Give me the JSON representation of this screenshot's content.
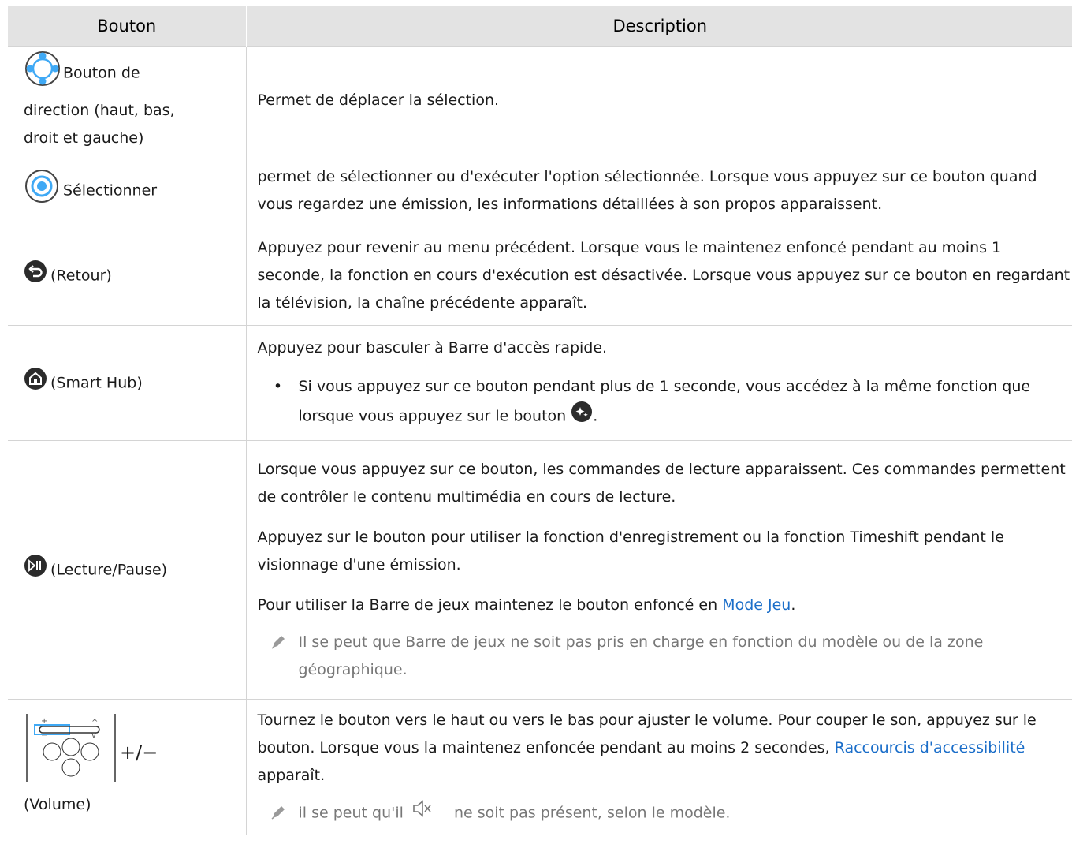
{
  "table": {
    "headers": [
      "Bouton",
      "Description"
    ],
    "rows": [
      {
        "button_label": "Bouton de direction (haut, bas, droit et gauche)",
        "icon": "direction-pad-icon",
        "description": [
          "Permet de déplacer la sélection."
        ]
      },
      {
        "button_label": "Sélectionner",
        "icon": "select-button-icon",
        "description": [
          "permet de sélectionner ou d'exécuter l'option sélectionnée. Lorsque vous appuyez sur ce bouton quand vous regardez une émission, les informations détaillées à son propos apparaissent."
        ]
      },
      {
        "button_label": "(Retour)",
        "icon": "back-icon",
        "description": [
          "Appuyez pour revenir au menu précédent. Lorsque vous le maintenez enfoncé pendant au moins 1 seconde, la fonction en cours d'exécution est désactivée. Lorsque vous appuyez sur ce bouton en regardant la télévision, la chaîne précédente apparaît."
        ]
      },
      {
        "button_label": "(Smart Hub)",
        "icon": "home-icon",
        "description": [
          "Appuyez pour basculer à Barre d'accès rapide."
        ],
        "bullet_text": "Si vous appuyez sur ce bouton pendant plus de 1 seconde, vous accédez à la même fonction que lorsque vous appuyez sur le bouton",
        "bullet_end": ".",
        "bullet_icon": "star-button-icon"
      },
      {
        "button_label": "(Lecture/Pause)",
        "icon": "play-pause-icon",
        "description": [
          "Lorsque vous appuyez sur ce bouton, les commandes de lecture apparaissent. Ces commandes permettent de contrôler le contenu multimédia en cours de lecture.",
          "Appuyez sur le bouton pour utiliser la fonction d'enregistrement ou la fonction Timeshift pendant le visionnage d'une émission."
        ],
        "p3_before": "Pour utiliser la Barre de jeux maintenez le bouton enfoncé en ",
        "p3_link": "Mode Jeu",
        "p3_after": ".",
        "note": "Il se peut que Barre de jeux ne soit pas pris en charge en fonction du modèle ou de la zone géographique."
      },
      {
        "button_label": "(Volume)",
        "icon": "volume-rocker-icon",
        "plus_minus": "+/−",
        "p1_before": "Tournez le bouton vers le haut ou vers le bas pour ajuster le volume. Pour couper le son, appuyez sur le bouton. Lorsque vous la maintenez enfoncée pendant au moins 2 secondes, ",
        "p1_link": "Raccourcis d'accessibilité",
        "p1_after": " apparaît.",
        "note_before": "il se peut qu'il",
        "note_after": "ne soit pas présent, selon le modèle.",
        "note_icon": "mute-icon"
      }
    ]
  },
  "colors": {
    "header_bg": "#e3e3e3",
    "border": "#d4d4d4",
    "link": "#1b6ec9",
    "note_text": "#777777",
    "icon_blue": "#3fa9f5"
  }
}
